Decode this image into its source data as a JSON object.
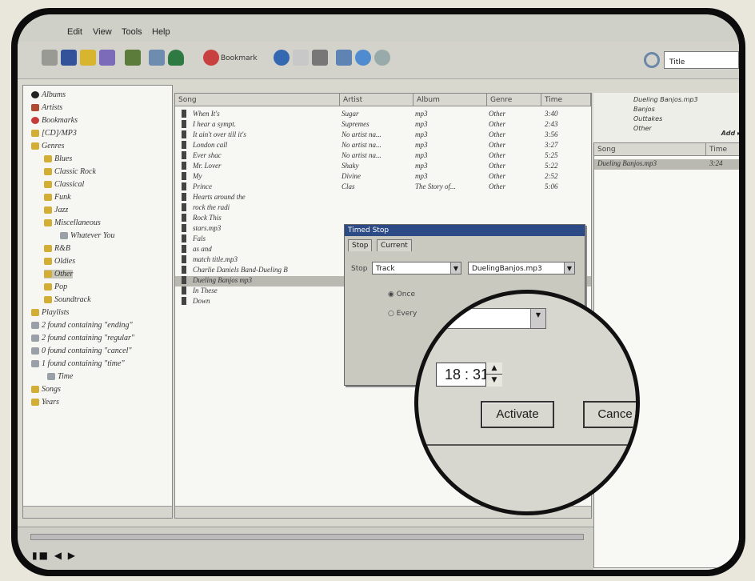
{
  "menubar": {
    "items": [
      "Edit",
      "View",
      "Tools",
      "Help"
    ]
  },
  "toolbar": {
    "bookmark_label": "Bookmark"
  },
  "search": {
    "value": "Title"
  },
  "tree": {
    "items": [
      "Albums",
      "Artists",
      "Bookmarks",
      "[CD]/MP3",
      "Genres",
      "Blues",
      "Classic Rock",
      "Classical",
      "Funk",
      "Jazz",
      "Miscellaneous",
      "Whatever You",
      "R&B",
      "Oldies",
      "Other",
      "Pop",
      "Soundtrack",
      "Playlists",
      "2 found containing \"ending\"",
      "2 found containing \"regular\"",
      "0 found containing \"cancel\"",
      "1 found containing \"time\"",
      "Time",
      "Songs",
      "Years"
    ]
  },
  "tracks": {
    "headers": [
      "Song",
      "Artist",
      "Album",
      "Genre",
      "Time"
    ],
    "rows": [
      [
        "When It's",
        "Sugar",
        "mp3",
        "Other",
        "3:40"
      ],
      [
        "I hear a sympt.",
        "Supremes",
        "mp3",
        "Other",
        "2:43"
      ],
      [
        "It ain't over till it's",
        "No artist na...",
        "mp3",
        "Other",
        "3:56"
      ],
      [
        "London call",
        "No artist na...",
        "mp3",
        "Other",
        "3:27"
      ],
      [
        "Ever shac",
        "No artist na...",
        "mp3",
        "Other",
        "5:25"
      ],
      [
        "Mr. Lover",
        "Shaky",
        "mp3",
        "Other",
        "5:22"
      ],
      [
        "My",
        "Divine",
        "mp3",
        "Other",
        "2:52"
      ],
      [
        "Prince",
        "Clas",
        "The Story of...",
        "Other",
        "5:06"
      ],
      [
        "Hearts around the",
        "",
        "",
        "",
        ""
      ],
      [
        "rock the radi",
        "",
        "",
        "",
        ""
      ],
      [
        "Rock This",
        "",
        "",
        "",
        ""
      ],
      [
        "stars.mp3",
        "",
        "",
        "",
        ""
      ],
      [
        "Fals",
        "",
        "",
        "",
        ""
      ],
      [
        "as and",
        "",
        "",
        "",
        ""
      ],
      [
        "match title.mp3",
        "",
        "",
        "",
        ""
      ],
      [
        "Charlie Daniels Band-Dueling B",
        "",
        "",
        "",
        ""
      ],
      [
        "Dueling Banjos mp3",
        "",
        "",
        "",
        ""
      ],
      [
        "In These",
        "",
        "",
        "",
        ""
      ],
      [
        "Down",
        "",
        "",
        "",
        ""
      ]
    ]
  },
  "info": {
    "lines": [
      "Dueling Banjos.mp3",
      "Banjos",
      "Outtakes",
      "Other"
    ],
    "add_button": "Add &#x25B8;",
    "list_header": [
      "Song",
      "Time"
    ],
    "list_row": [
      "Dueling Banjos.mp3",
      "3:24"
    ]
  },
  "dialog": {
    "title": "Timed Stop",
    "tabs": [
      "Stop",
      "Current"
    ],
    "stop_label": "Stop",
    "stop_select": "Track",
    "track_select": "DuelingBanjos.mp3",
    "radio_once": "Once",
    "radio_every": "Every"
  },
  "magnifier": {
    "time_value": "18 : 31",
    "activate_label": "Activate",
    "cancel_label": "Cance"
  },
  "playback": {
    "controls": "&#x25AE;&#x25A0; &#x25C0; &#x25B6;"
  }
}
